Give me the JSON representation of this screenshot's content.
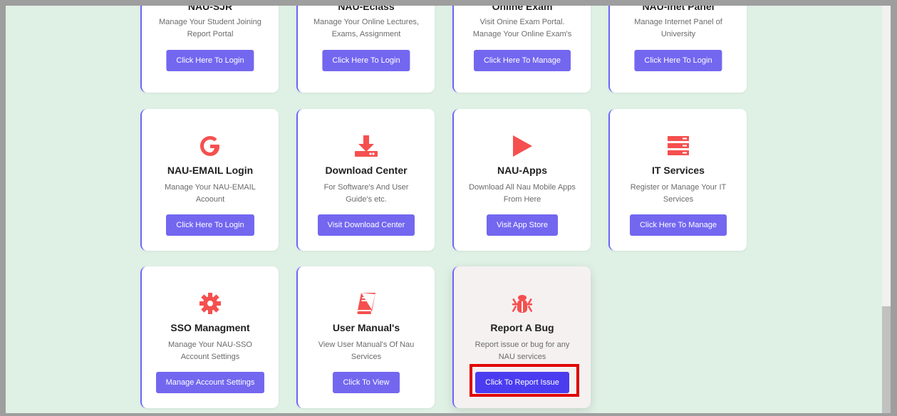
{
  "cards": [
    {
      "title": "NAU-SJR",
      "desc": "Manage Your Student Joining Report Portal",
      "button": "Click Here To Login",
      "icon": "none"
    },
    {
      "title": "NAU-Eclass",
      "desc": "Manage Your Online Lectures, Exams, Assignment",
      "button": "Click Here To Login",
      "icon": "none"
    },
    {
      "title": "Online Exam",
      "desc": "Visit Onine Exam Portal. Manage Your Online Exam's",
      "button": "Click Here To Manage",
      "icon": "none"
    },
    {
      "title": "NAU-Inet Panel",
      "desc": "Manage Internet Panel of University",
      "button": "Click Here To Login",
      "icon": "none"
    },
    {
      "title": "NAU-EMAIL Login",
      "desc": "Manage Your NAU-EMAIL Acoount",
      "button": "Click Here To Login",
      "icon": "google-icon"
    },
    {
      "title": "Download Center",
      "desc": "For Software's And User Guide's etc.",
      "button": "Visit Download Center",
      "icon": "download-icon"
    },
    {
      "title": "NAU-Apps",
      "desc": "Download All Nau Mobile Apps From Here",
      "button": "Visit App Store",
      "icon": "play-icon"
    },
    {
      "title": "IT Services",
      "desc": "Register or Manage Your IT Services",
      "button": "Click Here To Manage",
      "icon": "server-icon"
    },
    {
      "title": "SSO Managment",
      "desc": "Manage Your NAU-SSO Account Settings",
      "button": "Manage Account Settings",
      "icon": "gear-icon"
    },
    {
      "title": "User Manual's",
      "desc": "View User Manual's Of Nau Services",
      "button": "Click To View",
      "icon": "book-icon"
    },
    {
      "title": "Report A Bug",
      "desc": "Report issue or bug for any NAU services",
      "button": "Click To Report Issue",
      "icon": "bug-icon"
    }
  ],
  "colors": {
    "accent": "#7367f0",
    "icon": "#f5504f",
    "highlight": "#e00000",
    "background": "#dff0e4"
  }
}
